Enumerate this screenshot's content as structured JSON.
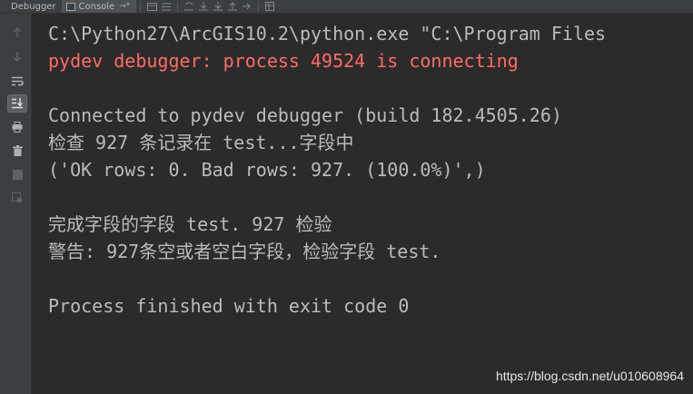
{
  "tabs": {
    "debugger_label": "Debugger",
    "console_label": "Console",
    "console_pin": "→*"
  },
  "toolbar_icons": [
    "restore-layout-icon",
    "list-icon",
    "step-over-icon",
    "step-into-icon",
    "step-out-icon",
    "run-to-cursor-icon",
    "evaluate-icon",
    "table-icon"
  ],
  "gutter_icons": [
    "arrow-up-icon",
    "arrow-down-icon",
    "soft-wrap-icon",
    "scroll-to-end-icon",
    "print-icon",
    "trash-icon",
    "stop-icon",
    "settings-icon"
  ],
  "console": {
    "lines": [
      {
        "text": "C:\\Python27\\ArcGIS10.2\\python.exe \"C:\\Program Files",
        "type": "normal"
      },
      {
        "text": "pydev debugger: process 49524 is connecting",
        "type": "error"
      },
      {
        "text": "",
        "type": "normal"
      },
      {
        "text": "Connected to pydev debugger (build 182.4505.26)",
        "type": "normal"
      },
      {
        "text": "检查 927 条记录在 test...字段中",
        "type": "normal"
      },
      {
        "text": "('OK rows: 0. Bad rows: 927. (100.0%)',)",
        "type": "normal"
      },
      {
        "text": "",
        "type": "normal"
      },
      {
        "text": "完成字段的字段 test. 927 检验",
        "type": "normal"
      },
      {
        "text": "警告: 927条空或者空白字段，检验字段 test.",
        "type": "normal"
      },
      {
        "text": "",
        "type": "normal"
      },
      {
        "text": "Process finished with exit code 0",
        "type": "normal"
      }
    ]
  },
  "watermark": "https://blog.csdn.net/u010608964",
  "colors": {
    "background": "#2b2b2b",
    "text": "#bbbbbb",
    "error_text": "#ff6b68",
    "panel": "#3c3f41"
  }
}
